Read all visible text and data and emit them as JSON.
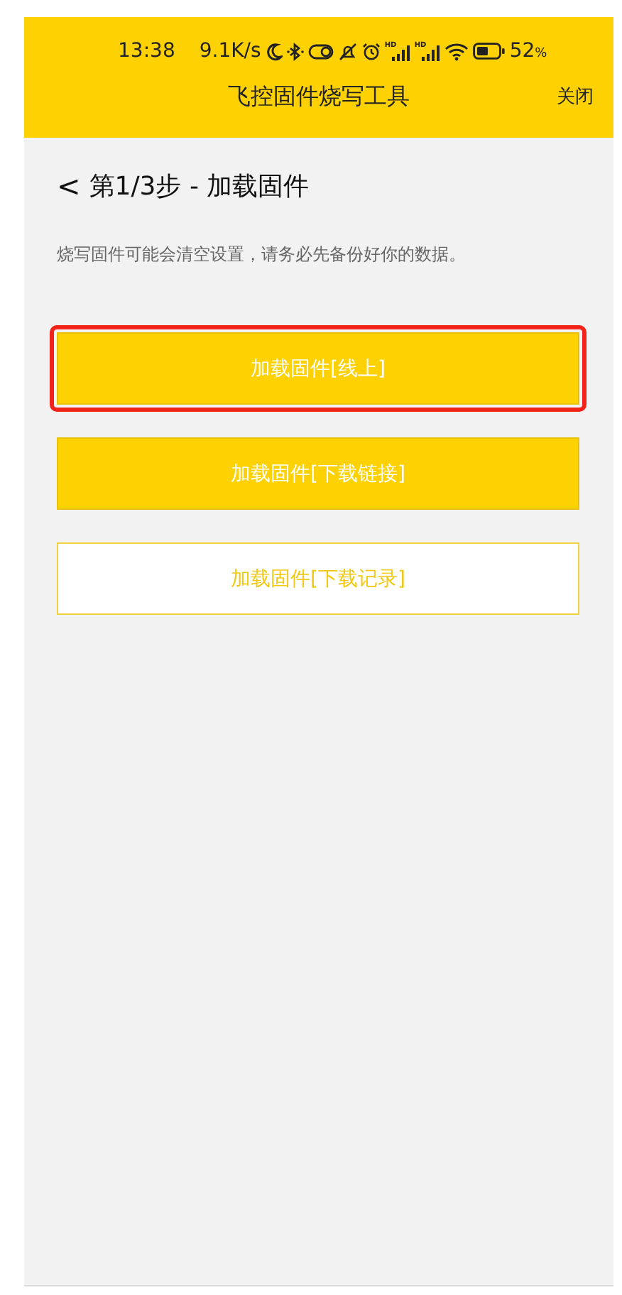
{
  "status_bar": {
    "time": "13:38",
    "speed": "9.1K/s",
    "signal_labels": [
      "HD",
      "HD"
    ],
    "battery_text": "52",
    "battery_unit": "%"
  },
  "header": {
    "title": "飞控固件烧写工具",
    "close": "关闭"
  },
  "step": {
    "back": "<",
    "title": "第1/3步 - 加载固件"
  },
  "warning": "烧写固件可能会清空设置，请务必先备份好你的数据。",
  "buttons": [
    {
      "label": "加载固件[线上]",
      "kind": "filled",
      "highlighted": true
    },
    {
      "label": "加载固件[下载链接]",
      "kind": "filled",
      "highlighted": false
    },
    {
      "label": "加载固件[下载记录]",
      "kind": "outline",
      "highlighted": false
    }
  ]
}
